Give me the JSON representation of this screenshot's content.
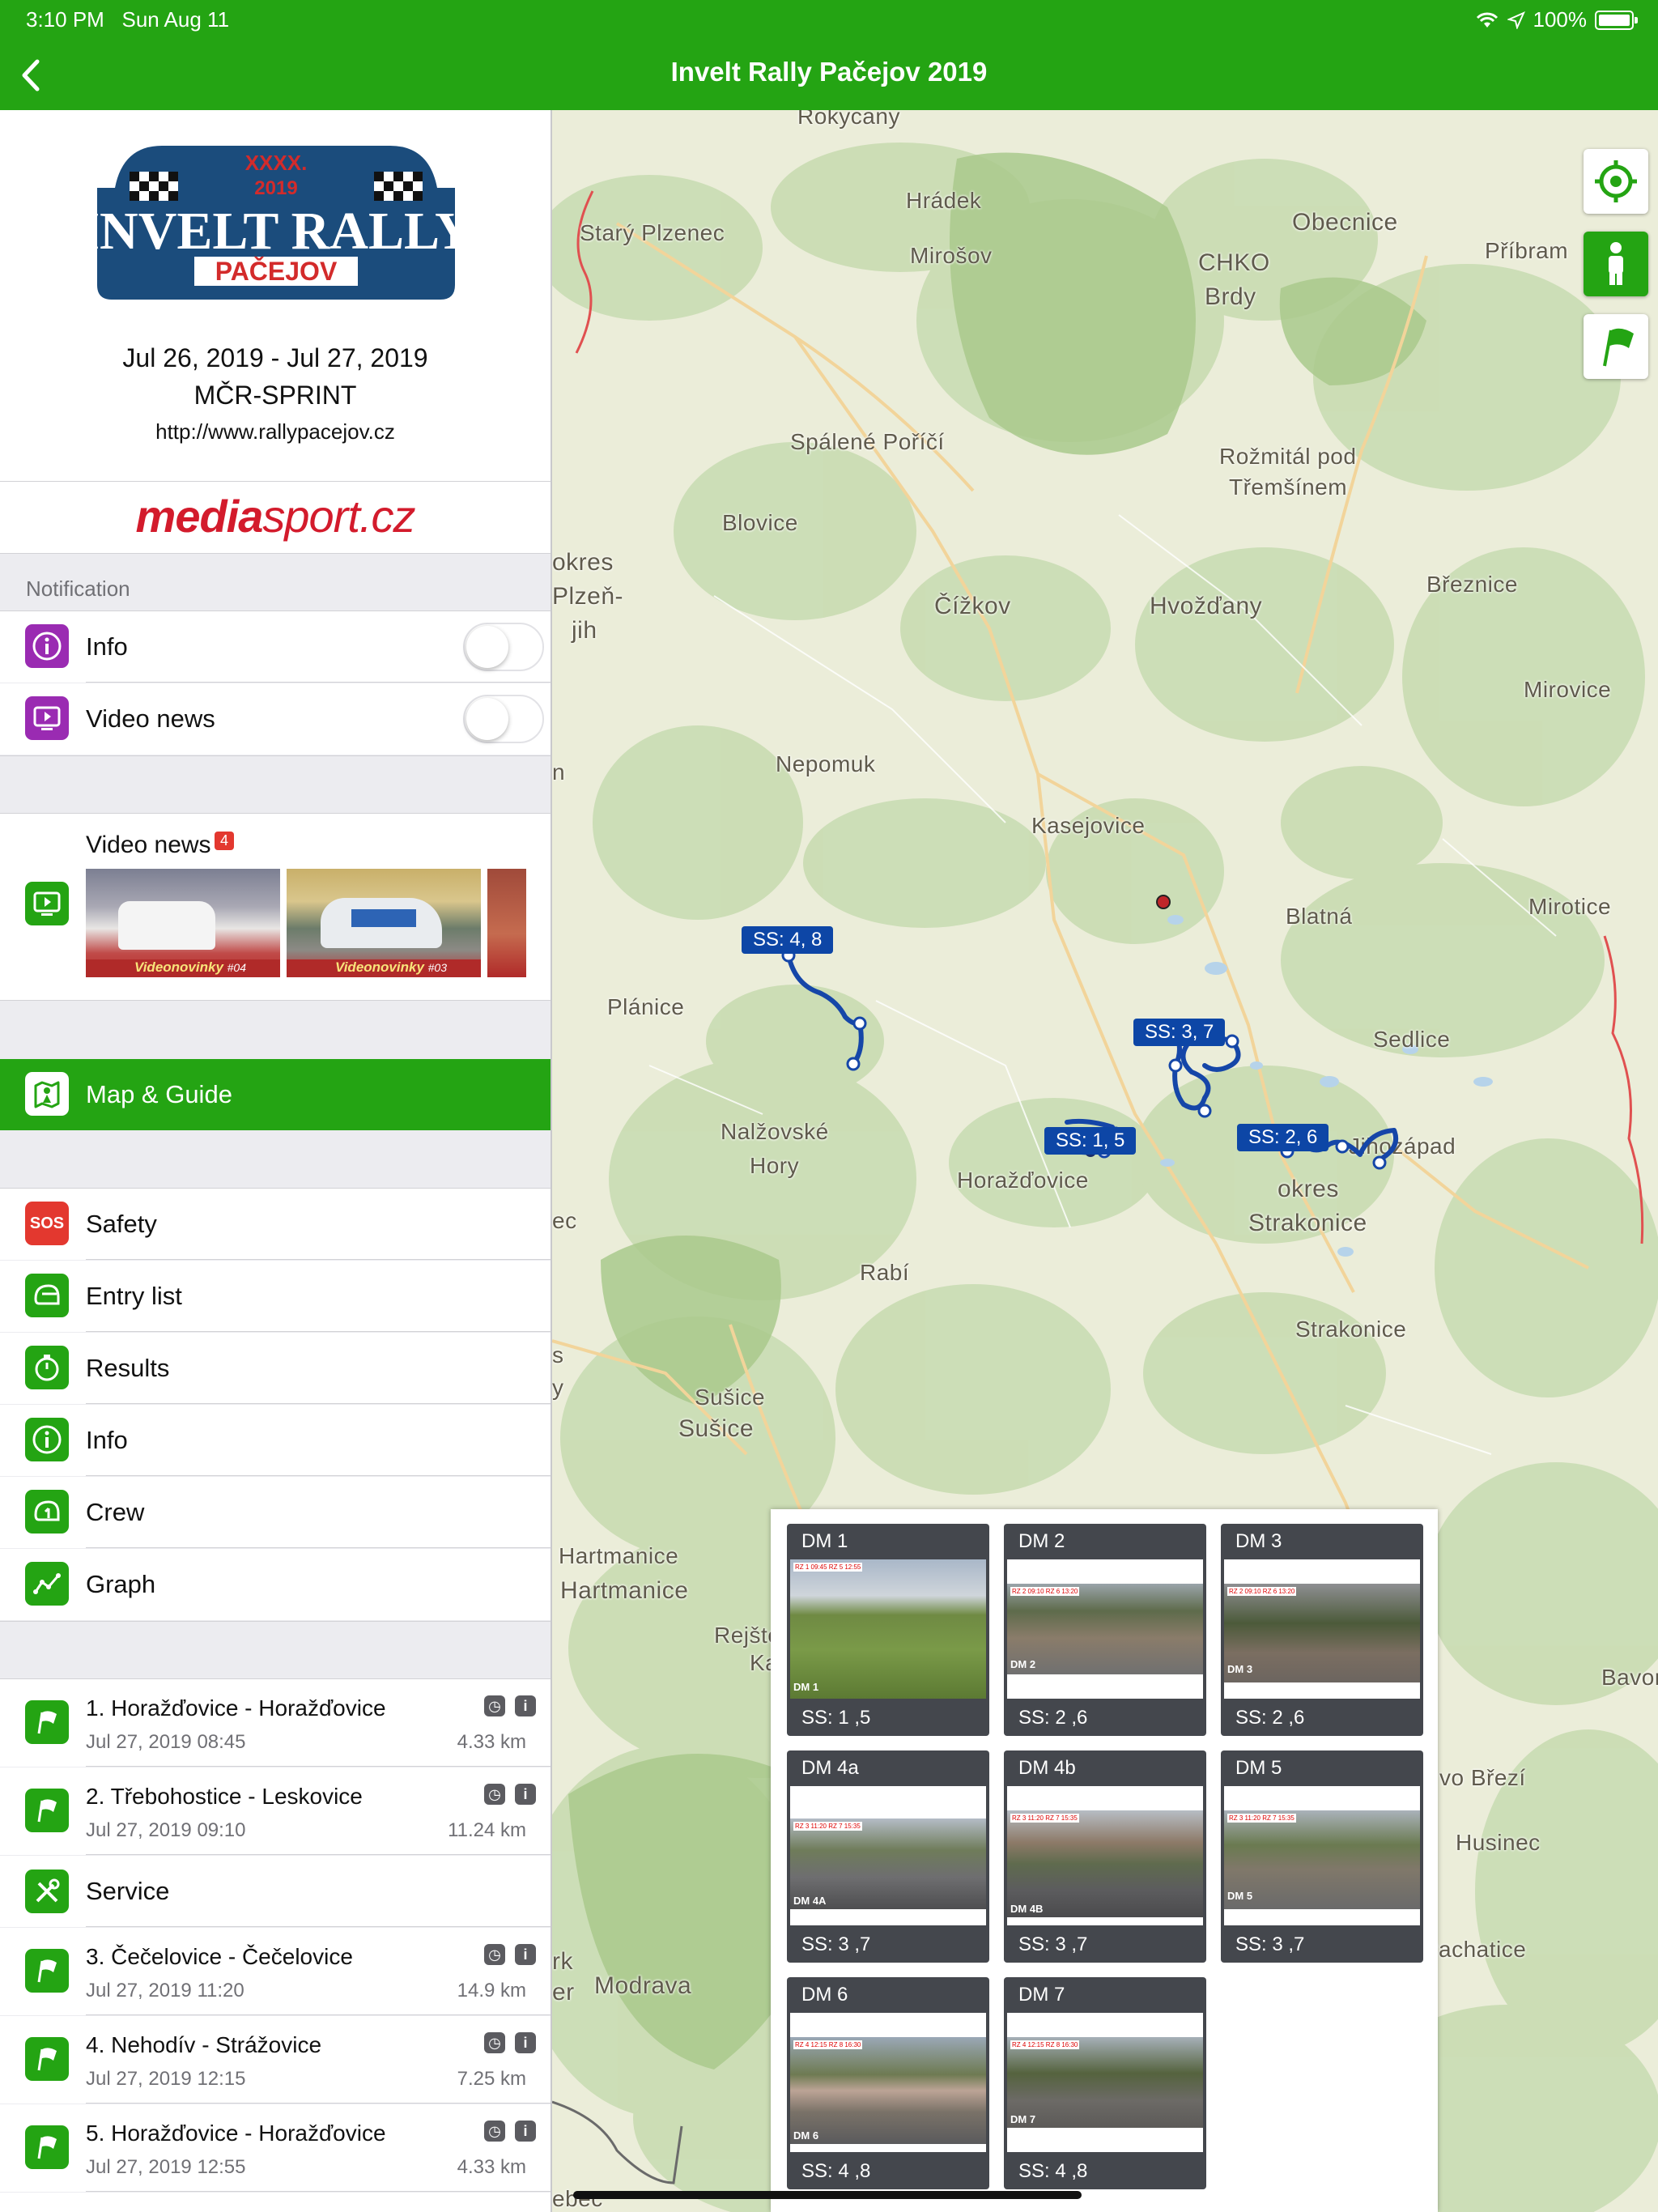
{
  "status": {
    "time": "3:10 PM",
    "date": "Sun Aug 11",
    "battery": "100%"
  },
  "nav": {
    "title": "Invelt Rally Pačejov 2019"
  },
  "event": {
    "logo_text": {
      "top": "XXXX.",
      "year": "2019",
      "main": "INVELT RALLY",
      "sub": "PAČEJOV"
    },
    "dates": "Jul 26, 2019 - Jul 27, 2019",
    "series": "MČR-SPRINT",
    "url": "http://www.rallypacejov.cz",
    "sponsor_a": "media",
    "sponsor_b": "sport.cz"
  },
  "notification": {
    "section": "Notification",
    "items": [
      {
        "label": "Info",
        "icon": "info-icon",
        "on": false
      },
      {
        "label": "Video news",
        "icon": "video-icon",
        "on": false
      }
    ]
  },
  "video_news": {
    "label": "Video news",
    "badge": "4",
    "thumbs": [
      {
        "caption": "Videonovinky",
        "num": "#04"
      },
      {
        "caption": "Videonovinky",
        "num": "#03"
      }
    ]
  },
  "menu": {
    "active": {
      "label": "Map & Guide",
      "icon": "map-guide-icon"
    },
    "items": [
      {
        "label": "Safety",
        "icon": "sos-icon",
        "icon_text": "SOS"
      },
      {
        "label": "Entry list",
        "icon": "helmet-icon"
      },
      {
        "label": "Results",
        "icon": "stopwatch-icon"
      },
      {
        "label": "Info",
        "icon": "info-icon"
      },
      {
        "label": "Crew",
        "icon": "crew-helmet-icon"
      },
      {
        "label": "Graph",
        "icon": "graph-icon"
      }
    ]
  },
  "stages": [
    {
      "name": "1. Horažďovice  - Horažďovice",
      "date": "Jul 27, 2019 08:45",
      "km": "4.33 km"
    },
    {
      "name": "2. Třebohostice - Leskovice",
      "date": "Jul 27, 2019 09:10",
      "km": "11.24 km"
    },
    {
      "name": "Service",
      "service": true
    },
    {
      "name": "3. Čečelovice - Čečelovice",
      "date": "Jul 27, 2019 11:20",
      "km": "14.9 km"
    },
    {
      "name": "4. Nehodív - Strážovice",
      "date": "Jul 27, 2019 12:15",
      "km": "7.25 km"
    },
    {
      "name": "5. Horažďovice  - Horažďovice",
      "date": "Jul 27, 2019 12:55",
      "km": "4.33 km"
    }
  ],
  "map": {
    "places": [
      "Rokycany",
      "Hrádek",
      "Starý Plzenec",
      "Mirošov",
      "Obecnice",
      "CHKO",
      "Brdy",
      "Příbram",
      "Spálené Poříčí",
      "Rožmitál pod",
      "Třemšínem",
      "Blovice",
      "okres",
      "Plzeň-",
      "jih",
      "Čížkov",
      "Hvožďany",
      "Březnice",
      "Mirovice",
      "Nepomuk",
      "Kasejovice",
      "Mirotice",
      "Blatná",
      "Plánice",
      "Sedlice",
      "Nalžovské",
      "Hory",
      "Horažďovice",
      "Jihozápad",
      "okres",
      "Strakonice",
      "Rabí",
      "Strakonice",
      "Sušice",
      "Sušice",
      "Hartmanice",
      "Hartmanice",
      "Rejštejn",
      "Bavor",
      "vo Březí",
      "Husinec",
      "Prachatice",
      "Modrava",
      "rk",
      "er",
      "n",
      "ebec",
      "ec",
      "s",
      "y",
      "Ka"
    ],
    "ss_labels": [
      "SS: 4, 8",
      "SS: 3, 7",
      "SS: 1, 5",
      "SS: 2, 6"
    ],
    "controls": [
      "crosshair-icon",
      "person-icon",
      "flag-icon"
    ]
  },
  "stage_cards": [
    {
      "title": "DM 1",
      "tag": "DM 1",
      "ss": "SS: 1 ,5",
      "times": "RZ 1  09:45 RZ 5  12:55"
    },
    {
      "title": "DM 2",
      "tag": "DM 2",
      "ss": "SS: 2 ,6",
      "times": "RZ 2  09:10 RZ 6  13:20"
    },
    {
      "title": "DM 3",
      "tag": "DM 3",
      "ss": "SS: 2 ,6",
      "times": "RZ 2  09:10 RZ 6  13:20"
    },
    {
      "title": "DM 4a",
      "tag": "DM 4A",
      "ss": "SS: 3 ,7",
      "times": "RZ 3  11:20 RZ 7  15:35"
    },
    {
      "title": "DM 4b",
      "tag": "DM 4B",
      "ss": "SS: 3 ,7",
      "times": "RZ 3  11:20 RZ 7  15:35"
    },
    {
      "title": "DM 5",
      "tag": "DM 5",
      "ss": "SS: 3 ,7",
      "times": "RZ 3  11:20 RZ 7  15:35"
    },
    {
      "title": "DM 6",
      "tag": "DM 6",
      "ss": "SS: 4 ,8",
      "times": "RZ 4  12:15 RZ 8  16:30"
    },
    {
      "title": "DM 7",
      "tag": "DM 7",
      "ss": "SS: 4 ,8",
      "times": "RZ 4  12:15 RZ 8  16:30"
    }
  ]
}
